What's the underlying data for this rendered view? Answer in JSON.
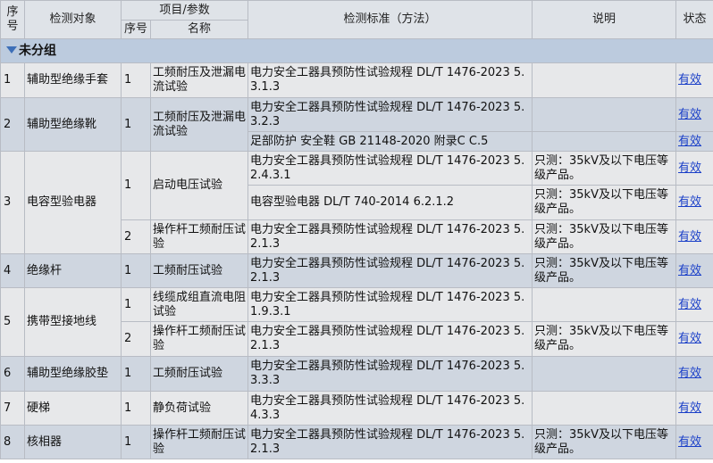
{
  "header": {
    "col_seq": "序号",
    "col_object": "检测对象",
    "col_item_group": "项目/参数",
    "col_item_seq": "序号",
    "col_item_name": "名称",
    "col_standard": "检测标准（方法）",
    "col_note": "说明",
    "col_status": "状态"
  },
  "group": {
    "label": "未分组"
  },
  "rows": {
    "r1": {
      "seq": "1",
      "object": "辅助型绝缘手套",
      "p1_seq": "1",
      "p1_name": "工频耐压及泄漏电流试验",
      "s1": "电力安全工器具预防性试验规程 DL/T 1476-2023 5.3.1.3",
      "s1_note": "",
      "s1_status": "有效"
    },
    "r2": {
      "seq": "2",
      "object": "辅助型绝缘靴",
      "p1_seq": "1",
      "p1_name": "工频耐压及泄漏电流试验",
      "s1": "电力安全工器具预防性试验规程 DL/T 1476-2023 5.3.2.3",
      "s1_note": "",
      "s1_status": "有效",
      "s2": "足部防护 安全鞋 GB 21148-2020 附录C C.5",
      "s2_note": "",
      "s2_status": "有效"
    },
    "r3": {
      "seq": "3",
      "object": "电容型验电器",
      "p1_seq": "1",
      "p1_name": "启动电压试验",
      "s1": "电力安全工器具预防性试验规程 DL/T 1476-2023 5.2.4.3.1",
      "s1_note": "只测：35kV及以下电压等级产品。",
      "s1_status": "有效",
      "s2": "电容型验电器 DL/T 740-2014 6.2.1.2",
      "s2_note": "只测：35kV及以下电压等级产品。",
      "s2_status": "有效",
      "p2_seq": "2",
      "p2_name": "操作杆工频耐压试验",
      "s3": "电力安全工器具预防性试验规程 DL/T 1476-2023 5.2.1.3",
      "s3_note": "只测：35kV及以下电压等级产品。",
      "s3_status": "有效"
    },
    "r4": {
      "seq": "4",
      "object": "绝缘杆",
      "p1_seq": "1",
      "p1_name": "工频耐压试验",
      "s1": "电力安全工器具预防性试验规程 DL/T 1476-2023 5.2.1.3",
      "s1_note": "只测：35kV及以下电压等级产品。",
      "s1_status": "有效"
    },
    "r5": {
      "seq": "5",
      "object": "携带型接地线",
      "p1_seq": "1",
      "p1_name": "线缆成组直流电阻试验",
      "s1": "电力安全工器具预防性试验规程 DL/T 1476-2023 5.1.9.3.1",
      "s1_note": "",
      "s1_status": "有效",
      "p2_seq": "2",
      "p2_name": "操作杆工频耐压试验",
      "s2": "电力安全工器具预防性试验规程 DL/T 1476-2023 5.2.1.3",
      "s2_note": "只测：35kV及以下电压等级产品。",
      "s2_status": "有效"
    },
    "r6": {
      "seq": "6",
      "object": "辅助型绝缘胶垫",
      "p1_seq": "1",
      "p1_name": "工频耐压试验",
      "s1": "电力安全工器具预防性试验规程 DL/T 1476-2023 5.3.3.3",
      "s1_note": "",
      "s1_status": "有效"
    },
    "r7": {
      "seq": "7",
      "object": "硬梯",
      "p1_seq": "1",
      "p1_name": "静负荷试验",
      "s1": "电力安全工器具预防性试验规程 DL/T 1476-2023 5.4.3.3",
      "s1_note": "",
      "s1_status": "有效"
    },
    "r8": {
      "seq": "8",
      "object": "核相器",
      "p1_seq": "1",
      "p1_name": "操作杆工频耐压试验",
      "s1": "电力安全工器具预防性试验规程 DL/T 1476-2023 5.2.1.3",
      "s1_note": "只测：35kV及以下电压等级产品。",
      "s1_status": "有效"
    }
  }
}
